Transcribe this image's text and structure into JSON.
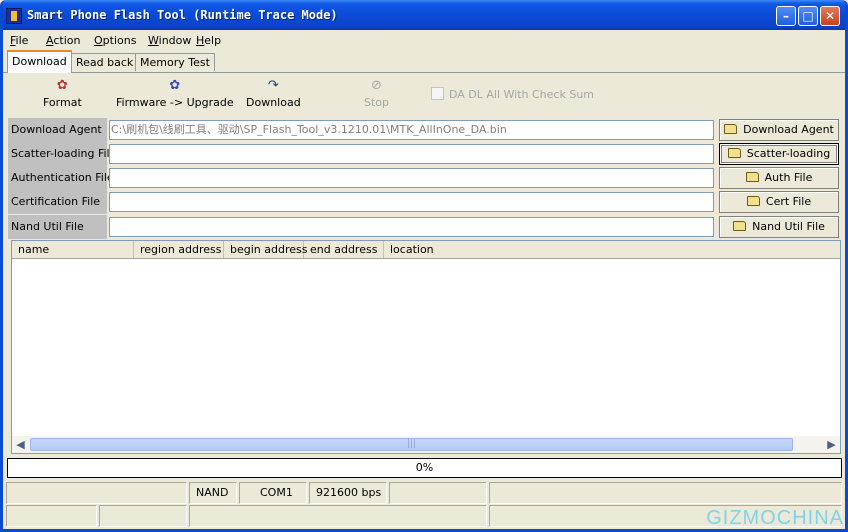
{
  "window": {
    "title": "Smart Phone Flash Tool (Runtime Trace Mode)"
  },
  "menu": [
    {
      "key": "F",
      "rest": "ile"
    },
    {
      "key": "A",
      "rest": "ction"
    },
    {
      "key": "O",
      "rest": "ptions"
    },
    {
      "key": "W",
      "rest": "indow"
    },
    {
      "key": "H",
      "rest": "elp"
    }
  ],
  "tabs": {
    "download": "Download",
    "readback": "Read back",
    "memtest": "Memory Test"
  },
  "toolbar": {
    "format": "Format",
    "upgrade": "Firmware -> Upgrade",
    "download": "Download",
    "stop": "Stop",
    "checksum": "DA DL All With Check Sum"
  },
  "files": {
    "da": {
      "label": "Download Agent",
      "value": "C:\\刷机包\\线刷工具、驱动\\SP_Flash_Tool_v3.1210.01\\MTK_AllInOne_DA.bin",
      "button": "Download Agent"
    },
    "scatter": {
      "label": "Scatter-loading File",
      "value": "",
      "button": "Scatter-loading"
    },
    "auth": {
      "label": "Authentication File",
      "value": "",
      "button": "Auth File"
    },
    "cert": {
      "label": "Certification File",
      "value": "",
      "button": "Cert File"
    },
    "nand": {
      "label": "Nand Util File",
      "value": "",
      "button": "Nand Util File"
    }
  },
  "list": {
    "columns": [
      "name",
      "region address",
      "begin address",
      "end address",
      "location"
    ]
  },
  "progress": {
    "text": "0%",
    "value": 0
  },
  "status": {
    "storage": "NAND",
    "port": "COM1",
    "baud": "921600 bps"
  },
  "watermark": "GIZMOCHINA"
}
